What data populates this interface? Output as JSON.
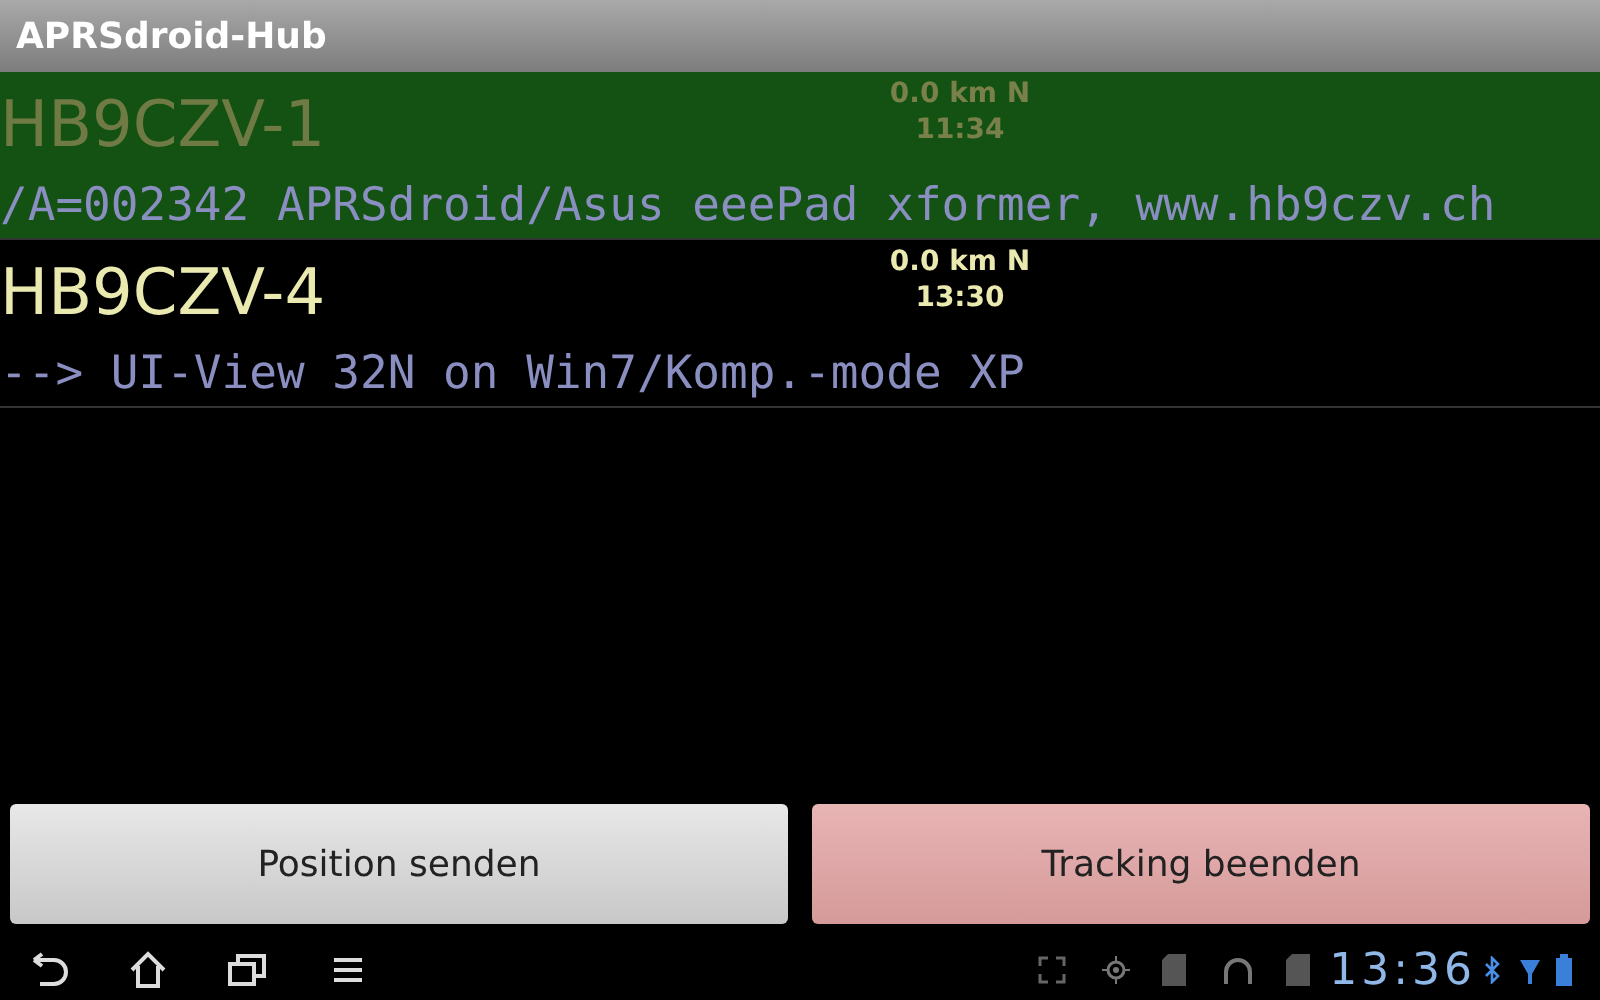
{
  "window": {
    "title": "APRSdroid-Hub"
  },
  "stations": [
    {
      "callsign": "HB9CZV-1",
      "distance": "0.0 km N",
      "time": "11:34",
      "comment": "/A=002342 APRSdroid/Asus eeePad xformer, www.hb9czv.ch",
      "selected": true
    },
    {
      "callsign": "HB9CZV-4",
      "distance": "0.0 km N",
      "time": "13:30",
      "comment": "--> UI-View 32N on Win7/Komp.-mode XP",
      "selected": false
    }
  ],
  "buttons": [
    {
      "label": "Position senden",
      "kind": "neutral"
    },
    {
      "label": "Tracking beenden",
      "kind": "stop"
    }
  ],
  "status_bar": {
    "clock": "13:36"
  }
}
